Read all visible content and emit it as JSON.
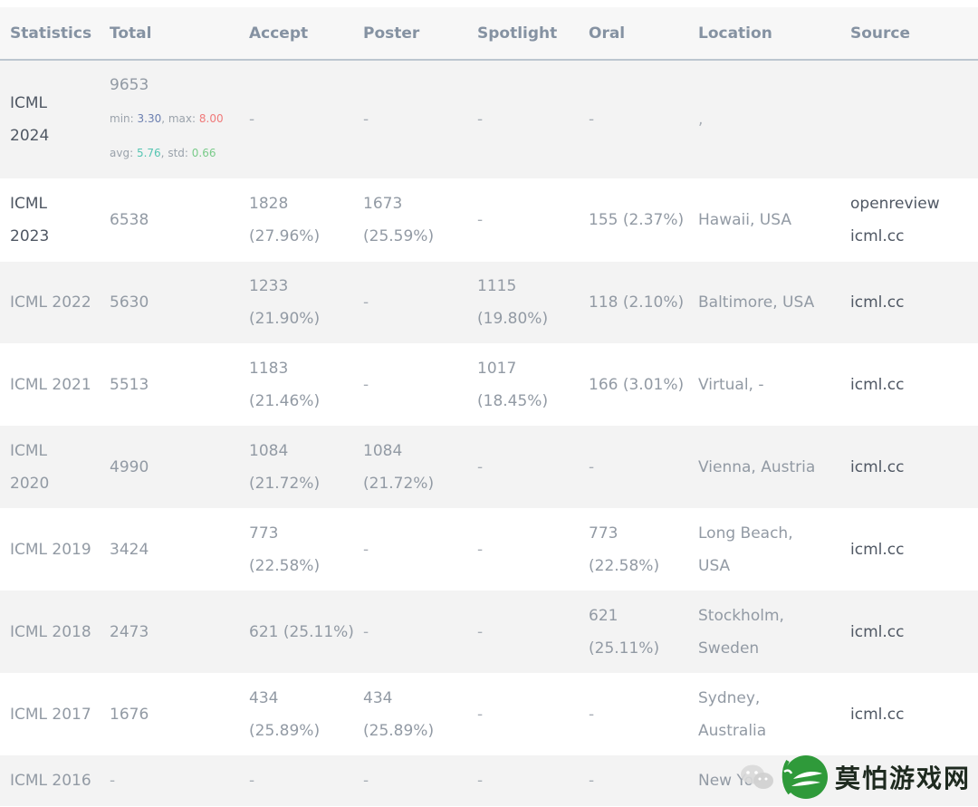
{
  "headers": [
    "Statistics",
    "Total",
    "Accept",
    "Poster",
    "Spotlight",
    "Oral",
    "Location",
    "Source"
  ],
  "rows": [
    {
      "name_line1": "ICML",
      "name_line2": "2024",
      "total": "9653",
      "stats": {
        "min_label": "min:",
        "min": "3.30",
        "max_label": "max:",
        "max": "8.00",
        "avg_label": "avg:",
        "avg": "5.76",
        "std_label": "std:",
        "std": "0.66"
      },
      "accept": "-",
      "poster": "-",
      "spotlight": "-",
      "oral": "-",
      "location": ",",
      "source": ""
    },
    {
      "name_line1": "ICML",
      "name_line2": "2023",
      "total": "6538",
      "accept_a": "1828",
      "accept_b": "(27.96%)",
      "poster_a": "1673",
      "poster_b": "(25.59%)",
      "spotlight": "-",
      "oral": "155 (2.37%)",
      "location": "Hawaii, USA",
      "source_a": "openreview",
      "source_b": "icml.cc"
    },
    {
      "name": "ICML 2022",
      "total": "5630",
      "accept_a": "1233",
      "accept_b": "(21.90%)",
      "poster": "-",
      "spotlight_a": "1115",
      "spotlight_b": "(19.80%)",
      "oral": "118 (2.10%)",
      "location": "Baltimore, USA",
      "source": "icml.cc"
    },
    {
      "name": "ICML 2021",
      "total": "5513",
      "accept_a": "1183",
      "accept_b": "(21.46%)",
      "poster": "-",
      "spotlight_a": "1017",
      "spotlight_b": "(18.45%)",
      "oral": "166 (3.01%)",
      "location": "Virtual, -",
      "source": "icml.cc"
    },
    {
      "name_line1": "ICML",
      "name_line2": "2020",
      "total": "4990",
      "accept_a": "1084",
      "accept_b": "(21.72%)",
      "poster_a": "1084",
      "poster_b": "(21.72%)",
      "spotlight": "-",
      "oral": "-",
      "location": "Vienna, Austria",
      "source": "icml.cc"
    },
    {
      "name": "ICML 2019",
      "total": "3424",
      "accept_a": "773",
      "accept_b": "(22.58%)",
      "poster": "-",
      "spotlight": "-",
      "oral_a": "773",
      "oral_b": "(22.58%)",
      "location_a": "Long Beach,",
      "location_b": "USA",
      "source": "icml.cc"
    },
    {
      "name": "ICML 2018",
      "total": "2473",
      "accept": "621 (25.11%)",
      "poster": "-",
      "spotlight": "-",
      "oral_a": "621",
      "oral_b": "(25.11%)",
      "location_a": "Stockholm,",
      "location_b": "Sweden",
      "source": "icml.cc"
    },
    {
      "name": "ICML 2017",
      "total": "1676",
      "accept_a": "434",
      "accept_b": "(25.89%)",
      "poster_a": "434",
      "poster_b": "(25.89%)",
      "spotlight": "-",
      "oral": "-",
      "location_a": "Sydney,",
      "location_b": "Australia",
      "source": "icml.cc"
    },
    {
      "name": "ICML 2016",
      "total": "-",
      "accept": "-",
      "poster": "-",
      "spotlight": "-",
      "oral": "-",
      "location": "New Yo",
      "source": ""
    }
  ],
  "watermark": {
    "text": "莫怕游戏网",
    "icon": "wechat-icon",
    "logo": "leaf-logo-icon",
    "logo_color": "#2f9a3a"
  }
}
